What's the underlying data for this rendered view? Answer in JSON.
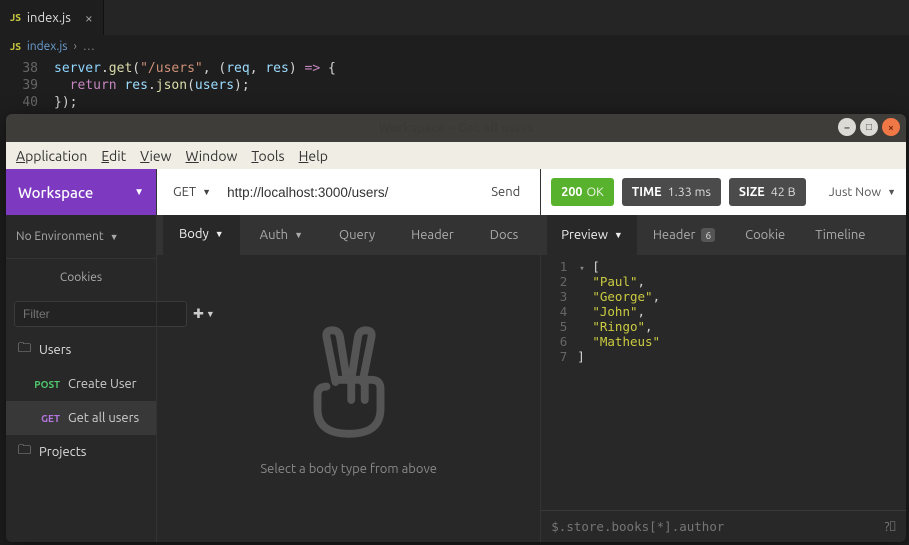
{
  "editor": {
    "tab_label": "index.js",
    "tab_badge": "JS",
    "breadcrumb_badge": "JS",
    "breadcrumb_file": "index.js",
    "breadcrumb_tail": "…",
    "lines": [
      {
        "n": "38",
        "html": "<span class='tok-obj'>server</span><span class='tok-plain'>.</span><span class='tok-fn'>get</span><span class='tok-par'>(</span><span class='tok-str'>\"/users\"</span><span class='tok-plain'>, (</span><span class='tok-arg'>req</span><span class='tok-plain'>, </span><span class='tok-arg'>res</span><span class='tok-plain'>) </span><span class='tok-kw'>=&gt;</span><span class='tok-plain'> {</span>"
      },
      {
        "n": "39",
        "html": "  <span class='tok-kw'>return</span> <span class='tok-arg'>res</span><span class='tok-plain'>.</span><span class='tok-fn'>json</span><span class='tok-par'>(</span><span class='tok-arg'>users</span><span class='tok-par'>)</span><span class='tok-plain'>;</span>"
      },
      {
        "n": "40",
        "html": "<span class='tok-plain'>});</span>"
      }
    ]
  },
  "window": {
    "title": "Workspace – Get all users",
    "menu": {
      "app": "Application",
      "edit": "Edit",
      "view": "View",
      "window": "Window",
      "tools": "Tools",
      "help": "Help"
    }
  },
  "sidebar": {
    "workspace": "Workspace",
    "environment": "No Environment",
    "cookies": "Cookies",
    "filter_placeholder": "Filter",
    "folders": [
      {
        "name": "Users",
        "requests": [
          {
            "method": "POST",
            "label": "Create User",
            "active": false
          },
          {
            "method": "GET",
            "label": "Get all users",
            "active": true
          }
        ]
      }
    ],
    "projects_label": "Projects"
  },
  "request": {
    "method": "GET",
    "url": "http://localhost:3000/users/",
    "send": "Send",
    "tabs": {
      "body": "Body",
      "auth": "Auth",
      "query": "Query",
      "header": "Header",
      "docs": "Docs"
    },
    "empty_text": "Select a body type from above"
  },
  "response": {
    "status_code": "200",
    "status_text": "OK",
    "time_label": "TIME",
    "time_value": "1.33 ms",
    "size_label": "SIZE",
    "size_value": "42 B",
    "history": "Just Now",
    "tabs": {
      "preview": "Preview",
      "header": "Header",
      "header_count": "6",
      "cookie": "Cookie",
      "timeline": "Timeline"
    },
    "json_lines": [
      {
        "n": "1",
        "text": "[",
        "is_string": false,
        "fold": true
      },
      {
        "n": "2",
        "text": "\"Paul\"",
        "is_string": true,
        "comma": true
      },
      {
        "n": "3",
        "text": "\"George\"",
        "is_string": true,
        "comma": true
      },
      {
        "n": "4",
        "text": "\"John\"",
        "is_string": true,
        "comma": true
      },
      {
        "n": "5",
        "text": "\"Ringo\"",
        "is_string": true,
        "comma": true
      },
      {
        "n": "6",
        "text": "\"Matheus\"",
        "is_string": true,
        "comma": false
      },
      {
        "n": "7",
        "text": "]",
        "is_string": false
      }
    ],
    "jsonpath_placeholder": "$.store.books[*].author"
  }
}
